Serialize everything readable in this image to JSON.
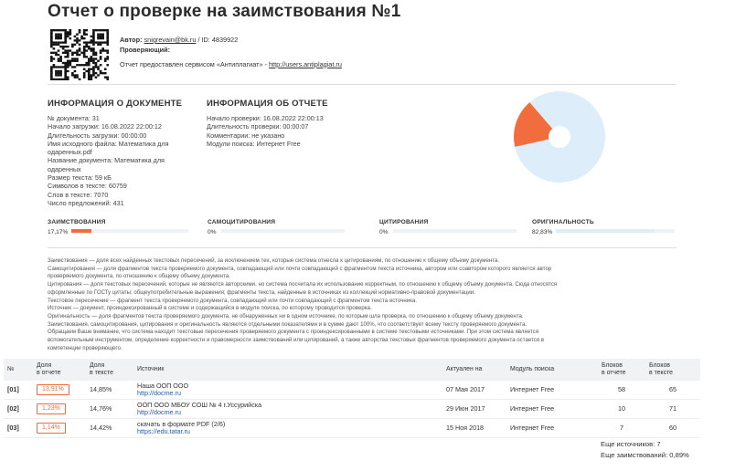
{
  "report": {
    "title": "Отчет о проверке на заимствования №1"
  },
  "meta": {
    "author_label": "Автор:",
    "author_email": "snigrevain@bk.ru",
    "author_id": "/ ID: 4839922",
    "checker_label": "Проверяющий:",
    "provider_text": "Отчет предоставлен сервисом «Антиплагиат» -",
    "provider_url": "http://users.antiplagiat.ru"
  },
  "doc_info": {
    "title": "ИНФОРМАЦИЯ О ДОКУМЕНТЕ",
    "lines": [
      "№ документа: 31",
      "Начало загрузки: 16.08.2022 22:00:12",
      "Длительность загрузки: 00:00:00",
      "Имя исходного файла: Математика для",
      "одаренных.pdf",
      "Название документа: Математика для",
      "одаренных",
      "Размер текста: 59 кБ",
      "Символов в тексте: 60759",
      "Слов в тексте: 7070",
      "Число предложений: 431"
    ]
  },
  "report_info": {
    "title": "ИНФОРМАЦИЯ ОБ ОТЧЕТЕ",
    "lines": [
      "Начало проверки: 16.08.2022 22:00:13",
      "Длительность проверки: 00:00:07",
      "Комментарии: не указано",
      "Модули поиска: Интернет Free"
    ]
  },
  "stats": [
    {
      "label": "ЗАИМСТВОВАНИЯ",
      "value": "17,17%",
      "percent": 17.17
    },
    {
      "label": "САМОЦИТИРОВАНИЯ",
      "value": "0%",
      "percent": 0
    },
    {
      "label": "ЦИТИРОВАНИЯ",
      "value": "0%",
      "percent": 0
    },
    {
      "label": "ОРИГИНАЛЬНОСТЬ",
      "value": "82,83%",
      "percent": 82.83
    }
  ],
  "colors": {
    "borrow": "#f26d3d",
    "original": "#ddeefa",
    "accent_link": "#1a5fb4"
  },
  "legend": [
    "Заимствования — доля всех найденных текстовых пересечений, за исключением тех, которые система отнесла к цитированиям, по отношению к общему объему документа.",
    "Самоцитирования — доля фрагментов текста проверяемого документа, совпадающий или почти совпадающий с фрагментом текста источника, автором или соавтором которого является автор",
    "проверяемого документа, по отношению к общему объему документа.",
    "Цитирования — доля текстовых пересечений, которые не являются авторскими, но система посчитала их использование корректным, по отношению к общему объему документа. Сюда относятся",
    "оформленные по ГОСТу цитаты; общеупотребительные выражения; фрагменты текста, найденные в источниках из коллекций нормативно-правовой документации.",
    "Текстовое пересечение — фрагмент текста проверяемого документа, совпадающий или почти совпадающий с фрагментом текста источника.",
    "Источник — документ, проиндексированный в системе и содержащийся в модуле поиска, по которому проводится проверка.",
    "Оригинальность — доля фрагментов текста проверяемого документа, не обнаруженных ни в одном источнике, по которым шла проверка, по отношению к общему объему документа.",
    "Заимствования, самоцитирования, цитирования и оригинальность являются отдельными показателями и в сумме дают 100%, что соответствует всему тексту проверяемого документа.",
    "Обращаем Ваше внимание, что система находит текстовые пересечения проверяемого документа с проиндексированными в системе текстовыми источниками. При этом система является",
    "вспомогательным инструментом, определение корректности и правомерности заимствований или цитирований, а также авторства текстовых фрагментов проверяемого документа остается в",
    "компетенции проверяющего."
  ],
  "table": {
    "headers": {
      "num": "№",
      "share_report": "Доля\nв отчете",
      "share_text": "Доля\nв тексте",
      "source": "Источник",
      "actual": "Актуален на",
      "module": "Модуль поиска",
      "blocks_report": "Блоков\nв отчете",
      "blocks_text": "Блоков\nв тексте"
    },
    "rows": [
      {
        "num": "[01]",
        "share_report": "13,91%",
        "share_text": "14,85%",
        "source_title": "Наша ООП ООО",
        "source_url": "http://docme.ru",
        "actual": "07 Мая 2017",
        "module": "Интернет Free",
        "blocks_report": "58",
        "blocks_text": "65"
      },
      {
        "num": "[02]",
        "share_report": "1,23%",
        "share_text": "14,76%",
        "source_title": "ООП ООО МБОУ СОШ № 4 г.Уссурийска",
        "source_url": "http://docme.ru",
        "actual": "29 Июн 2017",
        "module": "Интернет Free",
        "blocks_report": "10",
        "blocks_text": "71"
      },
      {
        "num": "[03]",
        "share_report": "1,14%",
        "share_text": "14,42%",
        "source_title": "скачать в формате PDF (2/6)",
        "source_url": "https://edu.tatar.ru",
        "actual": "15 Ноя 2018",
        "module": "Интернет Free",
        "blocks_report": "7",
        "blocks_text": "60"
      }
    ]
  },
  "summary": {
    "sources_label": "Еще источников:",
    "sources_value": "7",
    "borrow_label": "Еще заимствований:",
    "borrow_value": "0,89%"
  }
}
